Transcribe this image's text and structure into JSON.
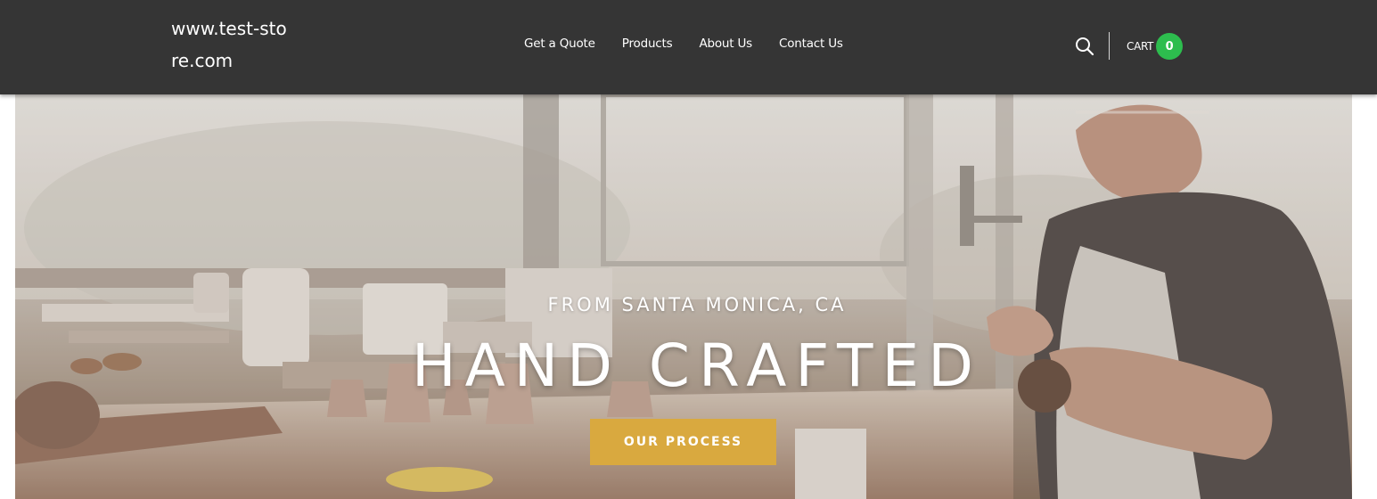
{
  "header": {
    "logo_text": "www.test-store.com",
    "nav": [
      {
        "label": "Get a Quote"
      },
      {
        "label": "Products"
      },
      {
        "label": "About Us"
      },
      {
        "label": "Contact Us"
      }
    ],
    "search_icon": "search-icon",
    "cart_label": "CART",
    "cart_count": "0"
  },
  "hero": {
    "subtitle": "FROM SANTA MONICA, CA",
    "title": "HAND CRAFTED",
    "cta_label": "OUR PROCESS"
  },
  "colors": {
    "header_bg": "#353535",
    "cart_badge": "#2dbd4e",
    "cta_bg": "#d9a93f",
    "text": "#ffffff"
  }
}
